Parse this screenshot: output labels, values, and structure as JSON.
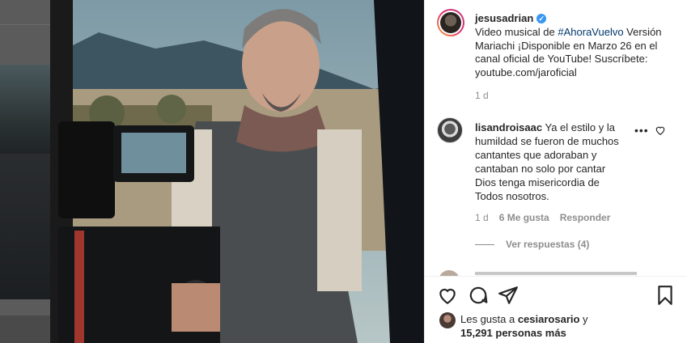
{
  "post": {
    "username": "jesusadrian",
    "verified_mark": "✓",
    "caption_pre": "Video musical de ",
    "caption_tag": "#AhoraVuelvo",
    "caption_post": " Versión Mariachi ¡Disponible en Marzo 26 en el canal oficial de YouTube! Suscríbete: youtube.com/jaroficial",
    "age": "1 d"
  },
  "comment": {
    "username": "lisandroisaac",
    "text": " Ya el estilo y la humildad se fueron de muchos cantantes que adoraban y cantaban no solo por cantar Dios tenga misericordia de Todos nosotros.",
    "more": "•••",
    "age": "1 d",
    "likes": "6 Me gusta",
    "reply": "Responder",
    "view_replies": "Ver respuestas (4)"
  },
  "likes_summary": {
    "prefix": "Les gusta a ",
    "user": "cesiarosario",
    "mid": " y",
    "count": "15,291 personas más"
  },
  "icons": {
    "like": "heart-icon",
    "comment": "comment-icon",
    "share": "paper-plane-icon",
    "save": "bookmark-icon",
    "comment_like": "heart-outline-icon",
    "verified": "verified-badge-icon"
  },
  "colors": {
    "link": "#00376b",
    "muted": "#8e8e8e",
    "verified": "#3897f0"
  }
}
